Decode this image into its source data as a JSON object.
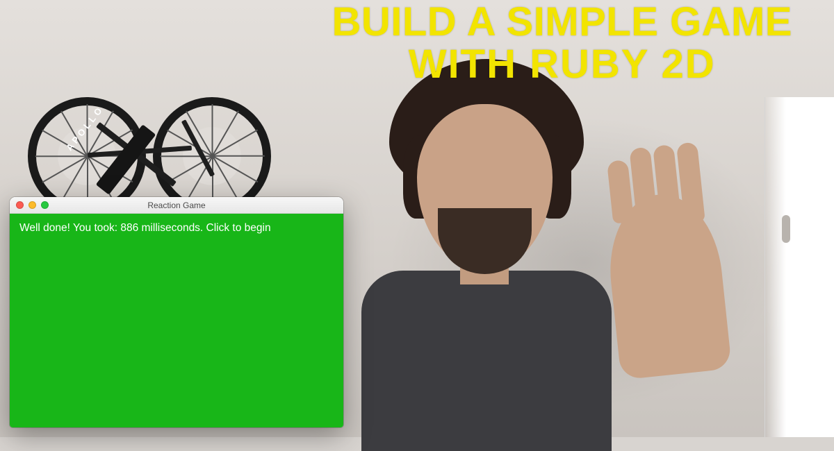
{
  "title": {
    "line1": "BUILD A SIMPLE GAME",
    "line2": "WITH RUBY 2D"
  },
  "bike": {
    "brand": "APOLLO"
  },
  "game_window": {
    "title": "Reaction Game",
    "message": "Well done! You took: 886 milliseconds. Click to begin"
  }
}
